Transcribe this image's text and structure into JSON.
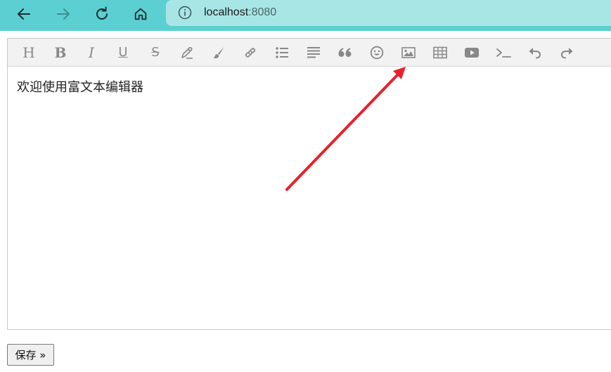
{
  "browser": {
    "url_host": "localhost",
    "url_port": ":8080",
    "nav_icons": [
      "back-arrow-icon",
      "forward-arrow-icon",
      "reload-icon",
      "home-icon",
      "info-icon"
    ]
  },
  "toolbar": {
    "heading_label": "H",
    "bold_label": "B",
    "italic_label": "I",
    "underline_label": "U",
    "strike_label": "S",
    "icons": [
      "heading",
      "bold",
      "italic",
      "underline",
      "strikethrough",
      "pen",
      "brush",
      "link",
      "unordered-list",
      "align-justify",
      "quote",
      "emoji",
      "image",
      "table",
      "video",
      "code",
      "undo",
      "redo"
    ]
  },
  "editor": {
    "content_text": "欢迎使用富文本编辑器"
  },
  "annotation": {
    "arrow_color": "#e8202a"
  },
  "save_button": {
    "label": "保存 »"
  },
  "colors": {
    "browser_bar": "#5ccfd2",
    "address_bar": "#a8e6e6",
    "toolbar_bg": "#f2f2f2",
    "icon_gray": "#888888"
  }
}
